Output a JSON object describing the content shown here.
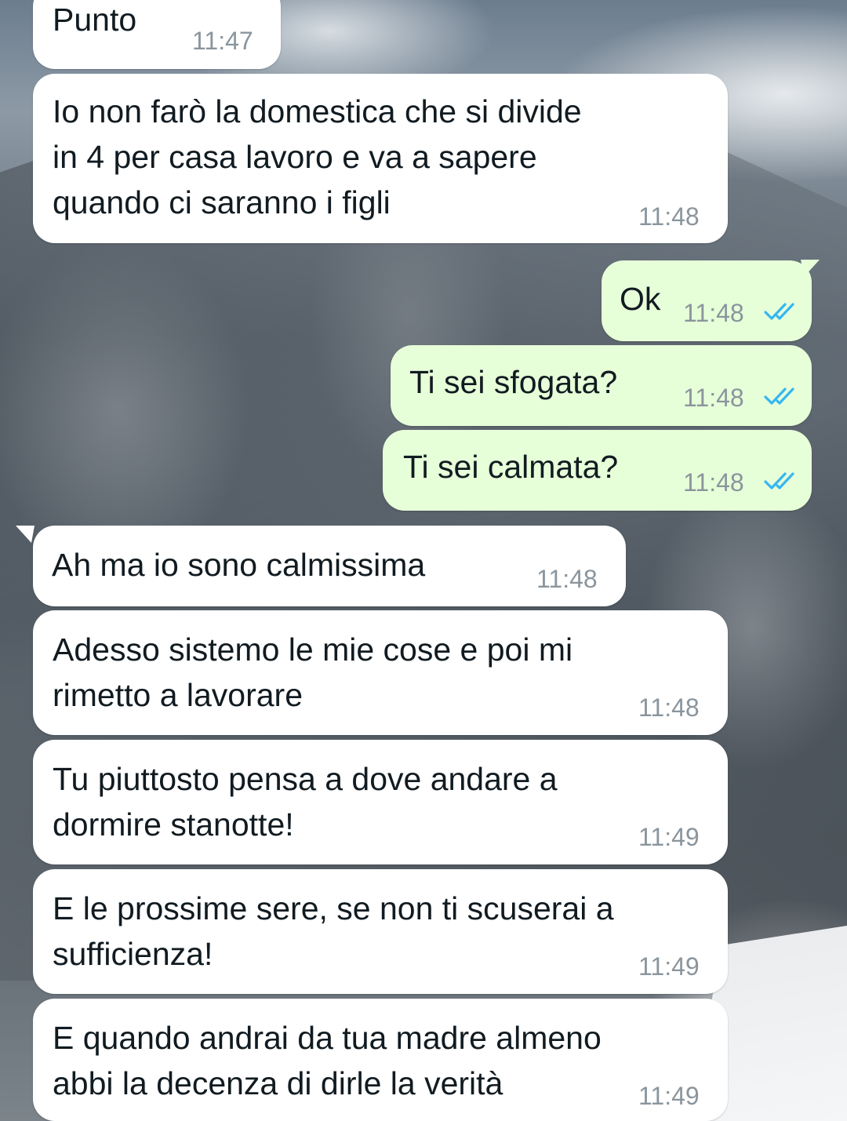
{
  "messages": [
    {
      "direction": "in",
      "text": "Punto",
      "time": "11:47"
    },
    {
      "direction": "in",
      "text": "Io non farò la domestica che si divide\nin 4 per casa lavoro e va a sapere\nquando ci saranno i figli",
      "time": "11:48"
    },
    {
      "direction": "out",
      "text": "Ok",
      "time": "11:48",
      "status": "read",
      "status_icon": "double-check-icon"
    },
    {
      "direction": "out",
      "text": "Ti sei sfogata?",
      "time": "11:48",
      "status": "read",
      "status_icon": "double-check-icon"
    },
    {
      "direction": "out",
      "text": "Ti sei calmata?",
      "time": "11:48",
      "status": "read",
      "status_icon": "double-check-icon"
    },
    {
      "direction": "in",
      "text": "Ah ma io sono calmissima",
      "time": "11:48"
    },
    {
      "direction": "in",
      "text": "Adesso sistemo le mie cose e poi mi\nrimetto a lavorare",
      "time": "11:48"
    },
    {
      "direction": "in",
      "text": "Tu piuttosto pensa a dove andare a\ndormire stanotte!",
      "time": "11:49"
    },
    {
      "direction": "in",
      "text": "E le prossime sere, se non ti scuserai a\nsufficienza!",
      "time": "11:49"
    },
    {
      "direction": "in",
      "text": "E quando andrai da tua madre almeno\nabbi la decenza di dirle la verità",
      "time": "11:49"
    }
  ],
  "colors": {
    "incoming_bubble": "#ffffff",
    "outgoing_bubble": "#e7ffd9",
    "text": "#111b21",
    "timestamp": "#8a959d",
    "read_ticks": "#34b7f1"
  }
}
